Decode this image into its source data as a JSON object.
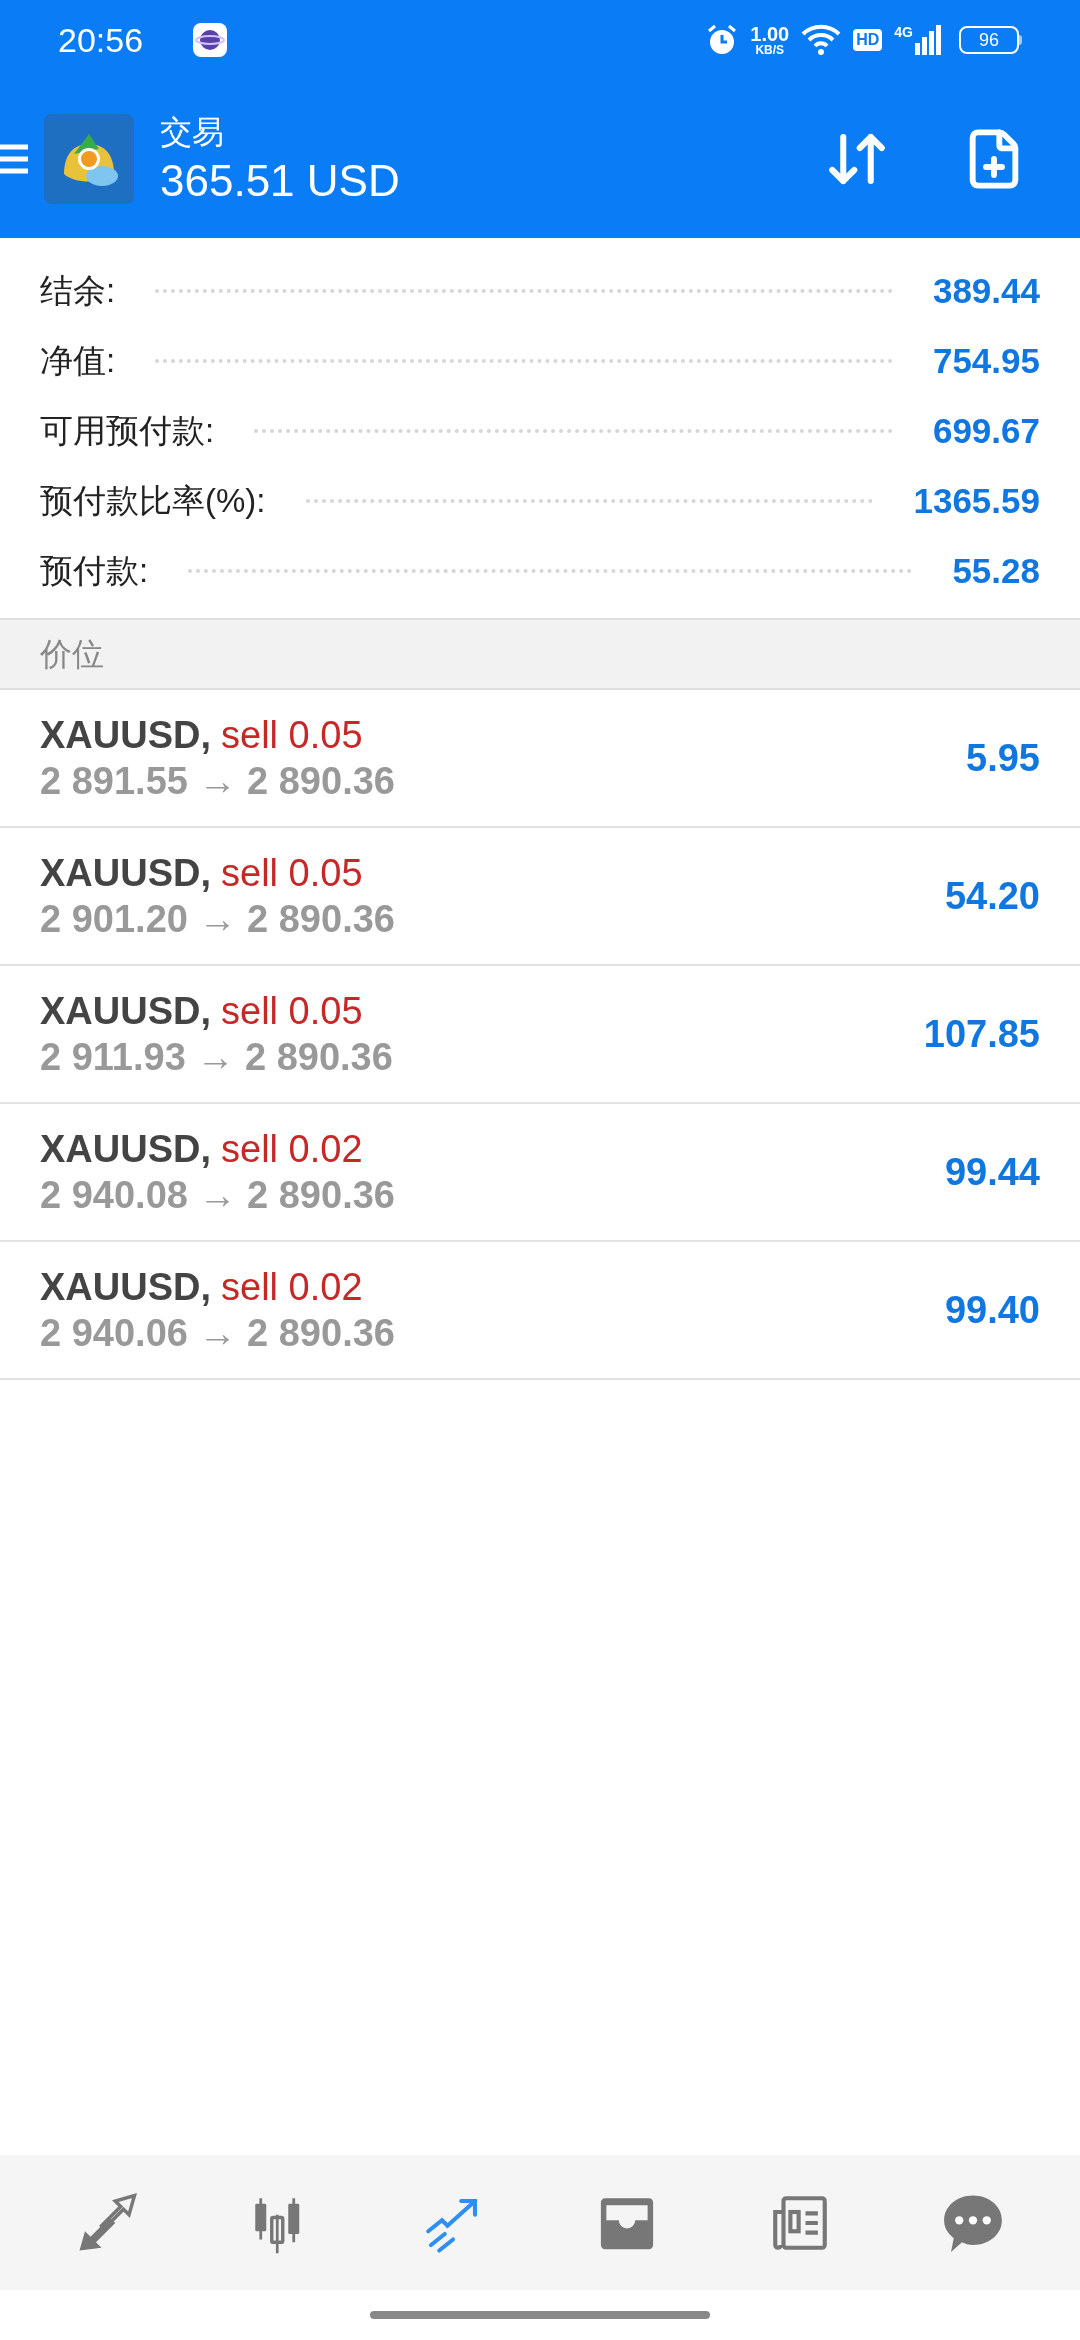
{
  "status_bar": {
    "time": "20:56",
    "speed": "1.00",
    "speed_unit": "KB/S",
    "hd": "HD",
    "network": "4G",
    "battery": "96"
  },
  "header": {
    "title": "交易",
    "balance": "365.51 USD"
  },
  "summary": [
    {
      "label": "结余:",
      "value": "389.44"
    },
    {
      "label": "净值:",
      "value": "754.95"
    },
    {
      "label": "可用预付款:",
      "value": "699.67"
    },
    {
      "label": "预付款比率(%):",
      "value": "1365.59"
    },
    {
      "label": "预付款:",
      "value": "55.28"
    }
  ],
  "section": {
    "title": "价位"
  },
  "positions": [
    {
      "symbol": "XAUUSD,",
      "order": "sell 0.05",
      "prices": "2 891.55 → 2 890.36",
      "profit": "5.95"
    },
    {
      "symbol": "XAUUSD,",
      "order": "sell 0.05",
      "prices": "2 901.20 → 2 890.36",
      "profit": "54.20"
    },
    {
      "symbol": "XAUUSD,",
      "order": "sell 0.05",
      "prices": "2 911.93 → 2 890.36",
      "profit": "107.85"
    },
    {
      "symbol": "XAUUSD,",
      "order": "sell 0.02",
      "prices": "2 940.08 → 2 890.36",
      "profit": "99.44"
    },
    {
      "symbol": "XAUUSD,",
      "order": "sell 0.02",
      "prices": "2 940.06 → 2 890.36",
      "profit": "99.40"
    }
  ],
  "nav": [
    {
      "kind": "quotes",
      "selected": false
    },
    {
      "kind": "chart",
      "selected": false
    },
    {
      "kind": "trade",
      "selected": true
    },
    {
      "kind": "history",
      "selected": false
    },
    {
      "kind": "news",
      "selected": false
    },
    {
      "kind": "chat",
      "selected": false
    }
  ]
}
